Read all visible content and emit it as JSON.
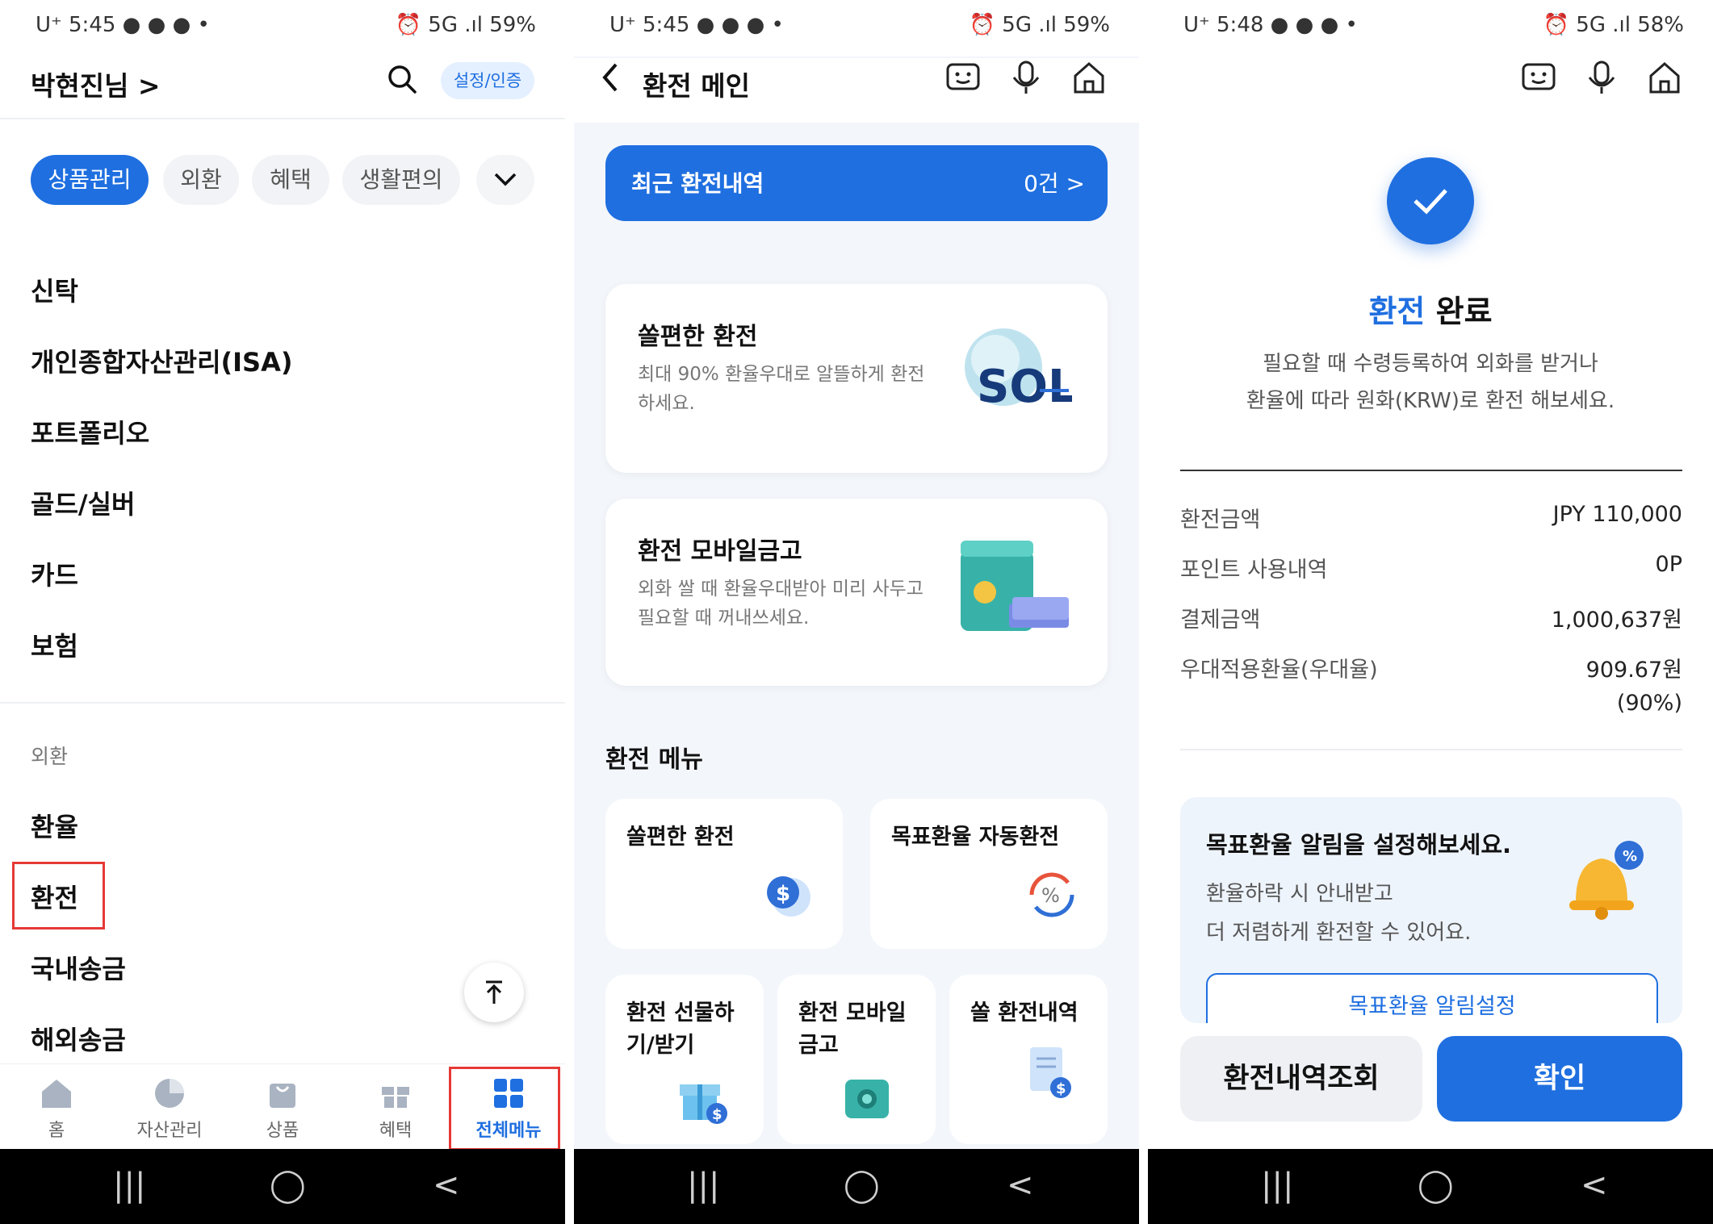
{
  "panel1": {
    "status": {
      "left": "U⁺ 5:45 ● ● ● •",
      "right": "⏰ 5G .ıl 59%"
    },
    "header": {
      "user_name": "박현진님 >",
      "cert_button": "설정/인증"
    },
    "chips": [
      "상품관리",
      "외환",
      "혜택",
      "생활편의"
    ],
    "menu_items_top": [
      "신탁",
      "개인종합자산관리(ISA)",
      "포트폴리오",
      "골드/실버",
      "카드",
      "보험"
    ],
    "section_label": "외환",
    "menu_items_fx": [
      "환율",
      "환전",
      "국내송금",
      "해외송금"
    ],
    "tabs": [
      {
        "label": "홈",
        "icon": "home-icon"
      },
      {
        "label": "자산관리",
        "icon": "pie-chart-icon"
      },
      {
        "label": "상품",
        "icon": "shopping-bag-icon"
      },
      {
        "label": "혜택",
        "icon": "gift-icon"
      },
      {
        "label": "전체메뉴",
        "icon": "grid-icon"
      }
    ]
  },
  "panel2": {
    "status": {
      "left": "U⁺ 5:45 ● ● ● •",
      "right": "⏰ 5G .ıl 59%"
    },
    "title": "환전 메인",
    "recent": {
      "title": "최근 환전내역",
      "count": "0건 >"
    },
    "cards": [
      {
        "title": "쏠편한 환전",
        "desc": "최대 90% 환율우대로 알뜰하게 환전하세요."
      },
      {
        "title": "환전 모바일금고",
        "desc": "외화 쌀 때 환율우대받아 미리 사두고 필요할 때 꺼내쓰세요."
      }
    ],
    "section_title": "환전 메뉴",
    "tiles_row1": [
      {
        "label": "쏠편한 환전",
        "icon": "dollar-exchange-icon"
      },
      {
        "label": "목표환율 자동환전",
        "icon": "percent-cycle-icon"
      }
    ],
    "tiles_row2": [
      {
        "label": "환전 선물하\n기/받기",
        "icon": "gift-dollar-icon"
      },
      {
        "label": "환전 모바일\n금고",
        "icon": "safe-icon"
      },
      {
        "label": "쏠 환전내역",
        "icon": "receipt-dollar-icon"
      }
    ]
  },
  "panel3": {
    "status": {
      "left": "U⁺ 5:48 ● ● ● •",
      "right": "⏰ 5G .ıl 58%"
    },
    "done_title_blue": "환전",
    "done_title_rest": " 완료",
    "done_desc_1": "필요할 때 수령등록하여 외화를 받거나",
    "done_desc_2": "환율에 따라 원화(KRW)로 환전 해보세요.",
    "rows": [
      {
        "label": "환전금액",
        "value": "JPY 110,000"
      },
      {
        "label": "포인트 사용내역",
        "value": "0P"
      },
      {
        "label": "결제금액",
        "value": "1,000,637원"
      },
      {
        "label": "우대적용환율(우대율)",
        "value": "909.67원"
      }
    ],
    "rate_note": "(90%)",
    "alert": {
      "title": "목표환율 알림을 설정해보세요.",
      "desc_1": "환율하락 시 안내받고",
      "desc_2": "더 저렴하게 환전할 수 있어요.",
      "button": "목표환율 알림설정"
    },
    "history_button": "환전내역조회",
    "confirm_button": "확인"
  },
  "nav_icons": {
    "recent": "|||",
    "home": "◯",
    "back": "<"
  },
  "colors": {
    "accent": "#1f6fe0",
    "highlight": "#e53935"
  }
}
